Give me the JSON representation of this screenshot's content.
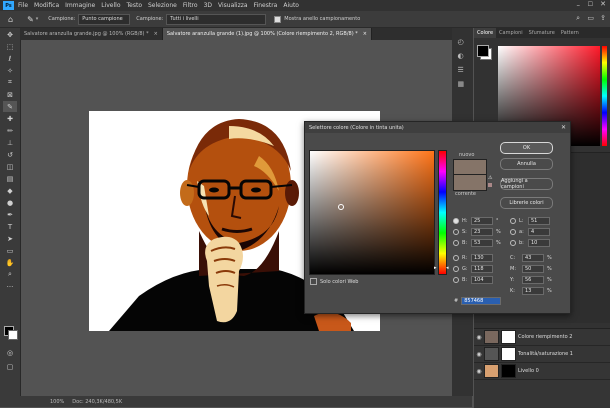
{
  "menubar": {
    "logo": "Ps",
    "items": [
      "File",
      "Modifica",
      "Immagine",
      "Livello",
      "Testo",
      "Selezione",
      "Filtro",
      "3D",
      "Visualizza",
      "Finestra",
      "Aiuto"
    ]
  },
  "options": {
    "sample_label": "Campione:",
    "sample_value": "Punto campione",
    "layers_label": "Campione:",
    "layers_value": "Tutti i livelli",
    "ring_label": "Mostra anello campionamento"
  },
  "tabs": [
    {
      "label": "Salvatore aranzulla grande.jpg @ 100% (RGB/8) *"
    },
    {
      "label": "Salvatore aranzulla grande (1).jpg @ 100% (Colore riempimento 2, RGB/8) *"
    }
  ],
  "status": {
    "text": "Doc: 240,3K/480,5K",
    "zoom": "100%"
  },
  "color_panel": {
    "tabs": [
      "Colore",
      "Campioni",
      "Sfumature",
      "Pattern"
    ]
  },
  "layers_panel": {
    "layers": [
      {
        "name": "Colore riempimento 2",
        "thumb": "#7a685e"
      },
      {
        "name": "Tonalità/saturazione 1",
        "thumb": "#ffffff"
      },
      {
        "name": "Livello 0",
        "thumb": "#d8a070"
      }
    ]
  },
  "dialog": {
    "title": "Selettore colore (Colore in tinta unita)",
    "new_label": "nuovo",
    "current_label": "corrente",
    "ok": "OK",
    "cancel": "Annulla",
    "add_swatch": "Aggiungi a campioni",
    "libraries": "Librerie colori",
    "web_only": "Solo colori Web",
    "hex_label": "#",
    "hex": "857468",
    "new_color": "#857468",
    "current_color": "#857468",
    "fields": {
      "H": "25",
      "S": "23",
      "B": "53",
      "R": "130",
      "G": "118",
      "Bl": "104",
      "L": "51",
      "a": "4",
      "b": "10",
      "C": "43",
      "M": "50",
      "Y": "56",
      "K": "13"
    },
    "units": {
      "deg": "°",
      "pct": "%"
    }
  }
}
